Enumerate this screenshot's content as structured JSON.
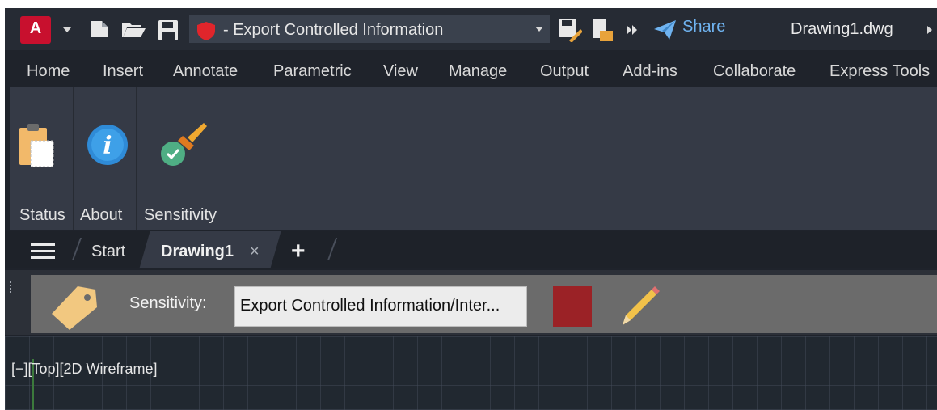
{
  "titlebar": {
    "app_logo": "A",
    "document_label": "- Export Controlled Information",
    "share_label": "Share",
    "filename": "Drawing1.dwg"
  },
  "menu": {
    "items": [
      "Home",
      "Insert",
      "Annotate",
      "Parametric",
      "View",
      "Manage",
      "Output",
      "Add-ins",
      "Collaborate",
      "Express Tools"
    ]
  },
  "ribbon": {
    "buttons": [
      {
        "label": "Status",
        "icon": "clipboard-icon"
      },
      {
        "label": "About",
        "icon": "info-icon"
      },
      {
        "label": "Sensitivity",
        "icon": "sensitivity-brush-icon"
      }
    ]
  },
  "doc_tabs": {
    "start": "Start",
    "active": "Drawing1",
    "close": "×",
    "new": "+"
  },
  "sensitivity_bar": {
    "label": "Sensitivity:",
    "value": "Export Controlled Information/Inter...",
    "color": "#9b2226"
  },
  "viewport": {
    "label": "[−][Top][2D Wireframe]"
  },
  "colors": {
    "logo_red": "#c8102e",
    "share_blue": "#6fb3f0",
    "shield_red": "#e0252b",
    "ribbon_bg": "#353a46"
  }
}
